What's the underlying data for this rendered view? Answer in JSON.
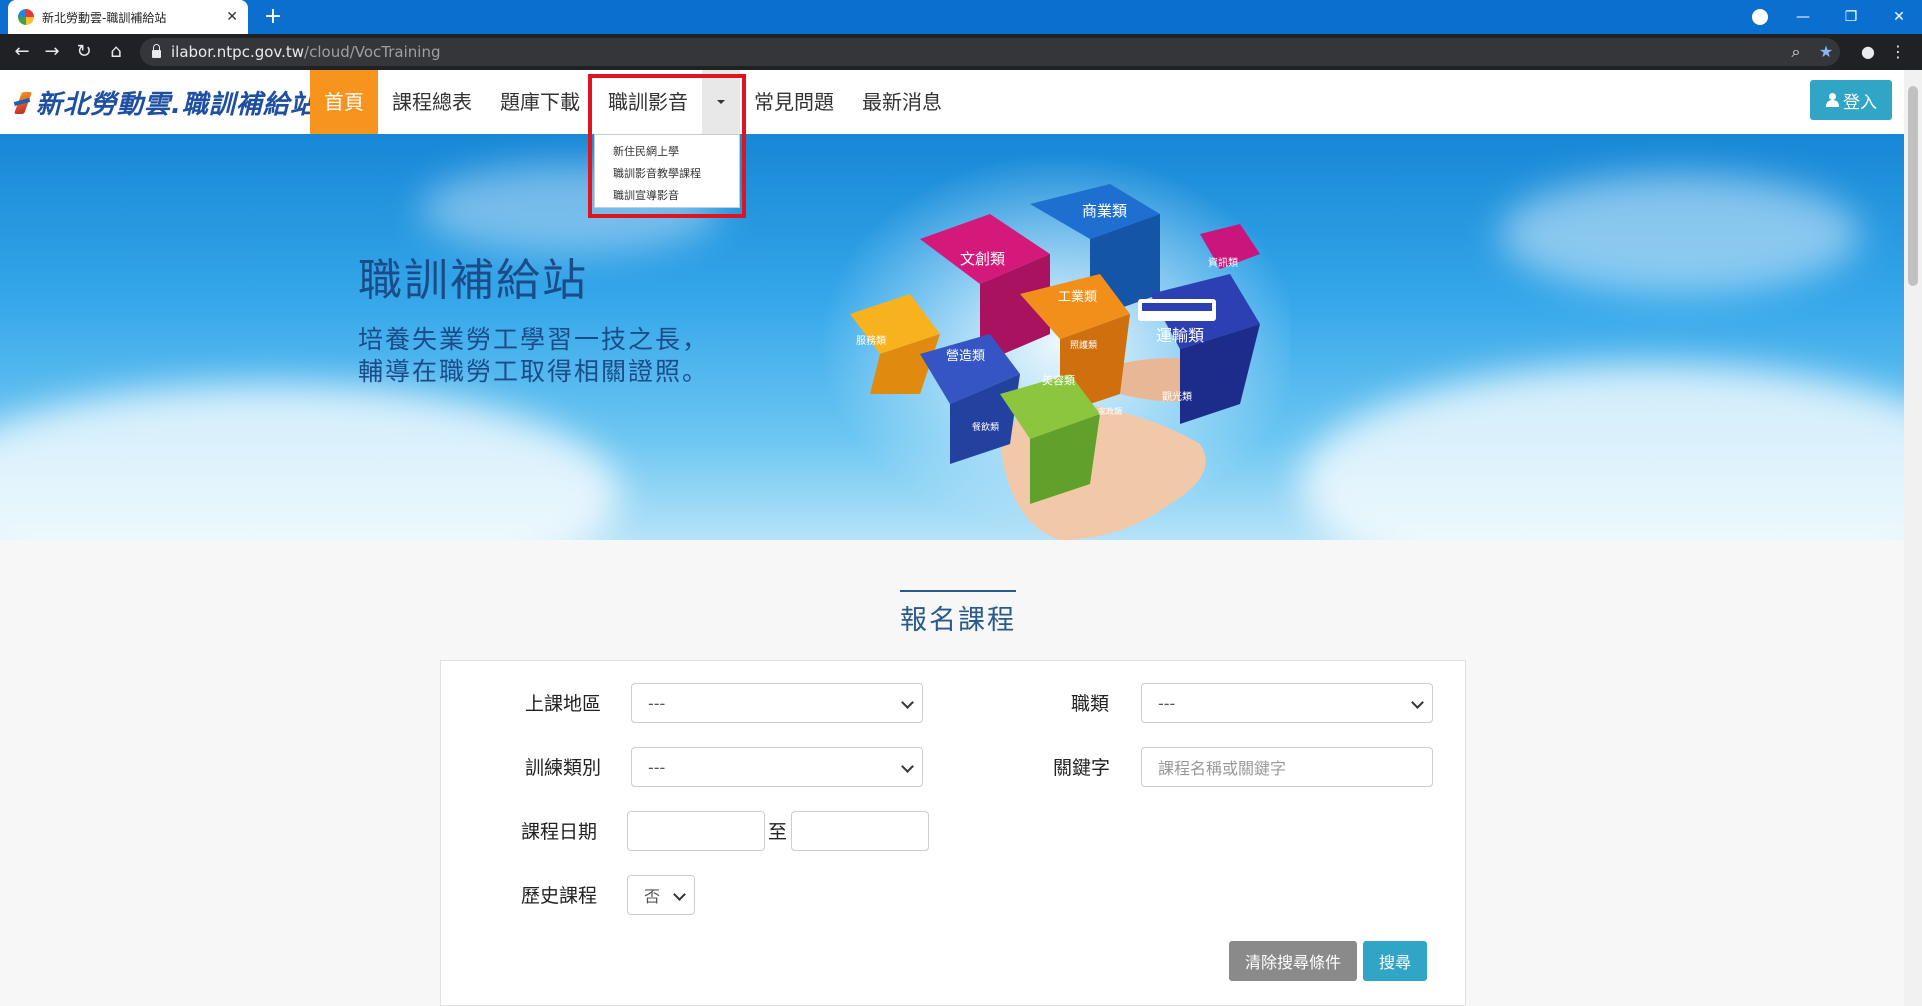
{
  "browser": {
    "tab_title": "新北勞動雲-職訓補給站",
    "url_host": "ilabor.ntpc.gov.tw",
    "url_path": "/cloud/VocTraining"
  },
  "site": {
    "logo_text": "新北勞動雲.職訓補給站",
    "menu": {
      "home": "首頁",
      "schedule": "課程總表",
      "question_bank": "題庫下載",
      "video": "職訓影音",
      "faq": "常見問題",
      "news": "最新消息"
    },
    "dropdown_items": [
      "新住民網上學",
      "職訓影音教學課程",
      "職訓宣導影音"
    ],
    "login_label": "登入"
  },
  "banner": {
    "title": "職訓補給站",
    "subtitle_line1": "培養失業勞工學習一技之長，",
    "subtitle_line2": "輔導在職勞工取得相關證照。",
    "categories": [
      "商業類",
      "文創類",
      "資訊類",
      "服務類",
      "工業類",
      "運輸類",
      "營造類",
      "照護類",
      "美容類",
      "觀光類",
      "家政類",
      "餐飲類"
    ]
  },
  "section": {
    "title": "報名課程",
    "labels": {
      "region": "上課地區",
      "job_type": "職類",
      "training_category": "訓練類別",
      "keyword": "關鍵字",
      "course_date": "課程日期",
      "date_to": "至",
      "history": "歷史課程"
    },
    "values": {
      "region": "---",
      "job_type": "---",
      "training_category": "---",
      "history": "否",
      "date_from": "",
      "date_until": ""
    },
    "keyword_placeholder": "課程名稱或關鍵字",
    "buttons": {
      "clear": "清除搜尋條件",
      "search": "搜尋"
    }
  },
  "colors": {
    "tabstrip": "#0b6fd0",
    "nav_active": "#f7941d",
    "login": "#31a5c6",
    "search_button": "#31a5c6",
    "clear_button": "#8a8a8a",
    "highlight": "#e0141e"
  }
}
